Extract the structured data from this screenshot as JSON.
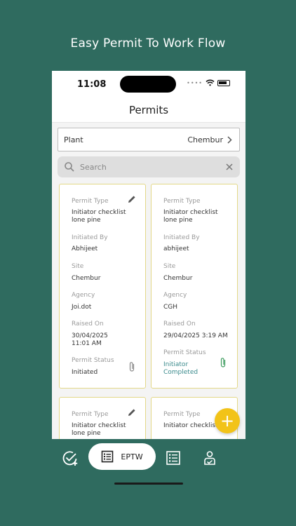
{
  "promo": {
    "title": "Easy Permit To Work Flow"
  },
  "status_bar": {
    "time": "11:08"
  },
  "header": {
    "title": "Permits"
  },
  "plant": {
    "label": "Plant",
    "value": "Chembur"
  },
  "search": {
    "placeholder": "Search"
  },
  "labels": {
    "permit_type": "Permit Type",
    "initiated_by": "Initiated By",
    "site": "Site",
    "agency": "Agency",
    "raised_on": "Raised On",
    "permit_status": "Permit Status"
  },
  "permits": [
    {
      "permit_type": "Initiator checklist lone pine",
      "initiated_by": "Abhijeet",
      "site": "Chembur",
      "agency": "Joi.dot",
      "raised_on": "30/04/2025 11:01 AM",
      "permit_status": "Initiated"
    },
    {
      "permit_type": "Initiator checklist lone pine",
      "initiated_by": "abhijeet",
      "site": "Chembur",
      "agency": "CGH",
      "raised_on": "29/04/2025 3:19 AM",
      "permit_status": "Initiator Completed"
    },
    {
      "permit_type": "Initiator checklist lone pine"
    },
    {
      "permit_type": "Initiator checklist lone pine"
    }
  ],
  "bottom_nav": {
    "active_label": "EPTW"
  },
  "fab": {
    "symbol": "+"
  },
  "colors": {
    "brand": "#2f6b5f",
    "card_border": "#e3d888",
    "fab": "#f2c318",
    "status_text": "#3a8a8c"
  }
}
